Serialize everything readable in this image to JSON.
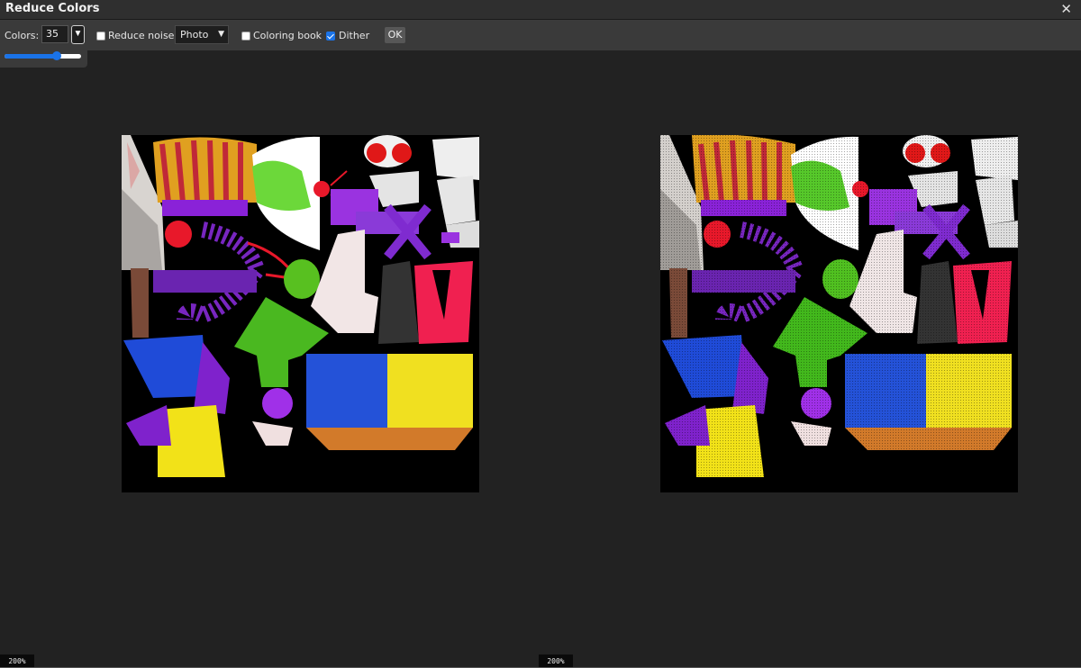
{
  "dialog": {
    "title": "Reduce Colors"
  },
  "toolbar": {
    "colors_label": "Colors:",
    "colors_value": "35",
    "reduce_noise": {
      "label": "Reduce noise",
      "checked": false
    },
    "mode_select": {
      "value": "Photo"
    },
    "coloring_book": {
      "label": "Coloring book",
      "checked": false
    },
    "dither": {
      "label": "Dither",
      "checked": true
    },
    "ok_label": "OK"
  },
  "slider": {
    "fraction": 0.68
  },
  "views": [
    {
      "zoom": "200%"
    },
    {
      "zoom": "200%"
    }
  ],
  "icons": {
    "close": "close-icon",
    "dropdown": "triangle-down-icon",
    "select_arrow": "chevron-down-icon"
  }
}
